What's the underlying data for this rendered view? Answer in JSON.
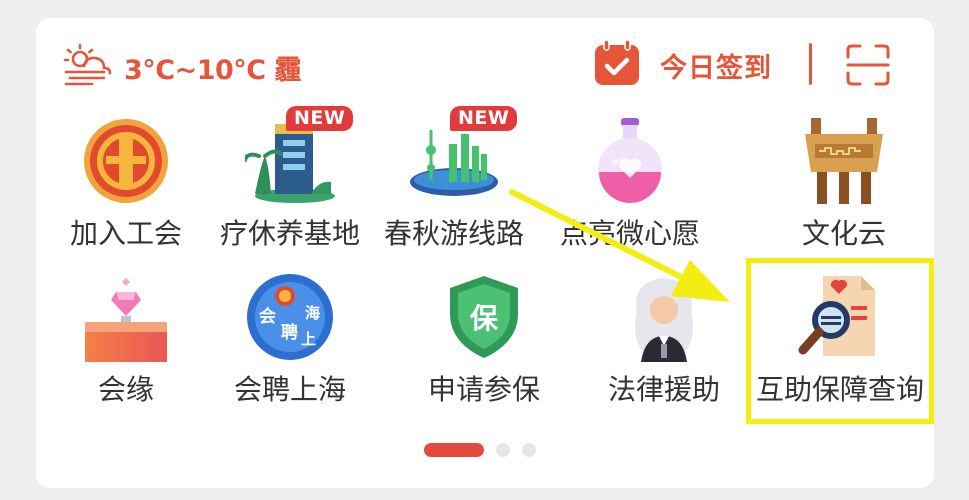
{
  "header": {
    "weather_icon": "sun-cloud-wind-icon",
    "weather_text": "3°C~10°C 霾",
    "checkin_icon": "calendar-check-icon",
    "checkin_label": "今日签到",
    "scan_icon": "scan-icon"
  },
  "grid": {
    "items": [
      {
        "label": "加入工会",
        "icon": "union-emblem-icon",
        "badge": ""
      },
      {
        "label": "疗休养基地",
        "icon": "resort-building-icon",
        "badge": "NEW"
      },
      {
        "label": "春秋游线路",
        "icon": "city-skyline-icon",
        "badge": "NEW"
      },
      {
        "label": "点亮微心愿",
        "icon": "heart-potion-icon",
        "badge": ""
      },
      {
        "label": "文化云",
        "icon": "bronze-ding-icon",
        "badge": ""
      },
      {
        "label": "会缘",
        "icon": "diamond-ring-box-icon",
        "badge": ""
      },
      {
        "label": "会聘上海",
        "icon": "recruitment-globe-icon",
        "badge": ""
      },
      {
        "label": "申请参保",
        "icon": "insurance-shield-icon",
        "text_on_icon": "保",
        "badge": ""
      },
      {
        "label": "法律援助",
        "icon": "judge-icon",
        "badge": ""
      },
      {
        "label": "互助保障查询",
        "icon": "document-search-icon",
        "badge": ""
      }
    ]
  },
  "globe_text": [
    "会",
    "聘",
    "上",
    "海"
  ],
  "pagination": {
    "current": 1,
    "total": 3
  },
  "colors": {
    "accent": "#e4553a",
    "highlight": "#f2ee12",
    "badge": "#e23b3b"
  }
}
